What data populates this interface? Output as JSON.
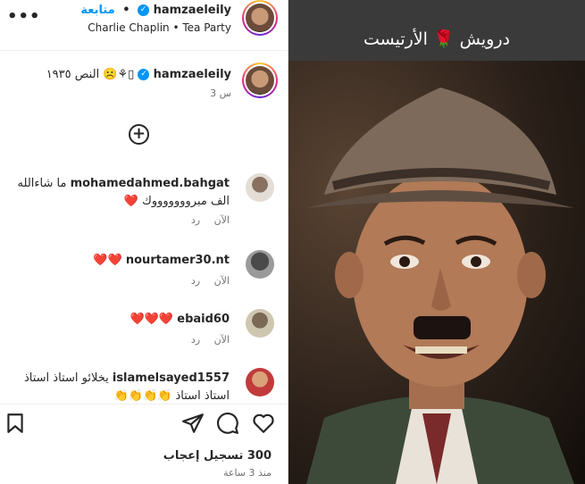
{
  "header": {
    "username": "hamzaeleily",
    "follow_label": "متابعة",
    "audio": "Charlie Chaplin • Tea Party",
    "more_icon": "more-horizontal-icon"
  },
  "caption": {
    "username": "hamzaeleily",
    "text": "النص ١٩٣٥ ☹️⚘️▯",
    "time": "3 س"
  },
  "photo": {
    "overlay_text": "درويش 🌹 الأرتيست"
  },
  "comments": [
    {
      "username": "mohamedahmed.bahgat",
      "text": "ما شاءالله الف مبروووووووك ❤️",
      "time": "الآن",
      "reply": "رد"
    },
    {
      "username": "nourtamer30.nt",
      "text": "❤️❤️",
      "time": "الآن",
      "reply": "رد"
    },
    {
      "username": "ebaid60",
      "text": "❤️❤️❤️",
      "time": "الآن",
      "reply": "رد"
    },
    {
      "username": "islamelsayed1557",
      "text": "يخلائو استاذ استاذ استاذ استاذ 👏👏👏👏",
      "time": "",
      "reply": ""
    }
  ],
  "footer": {
    "likes": "300 تسجيل إعجاب",
    "time_ago": "منذ 3 ساعة"
  },
  "colors": {
    "accent": "#0095f6",
    "text": "#262626",
    "muted": "#737373"
  }
}
